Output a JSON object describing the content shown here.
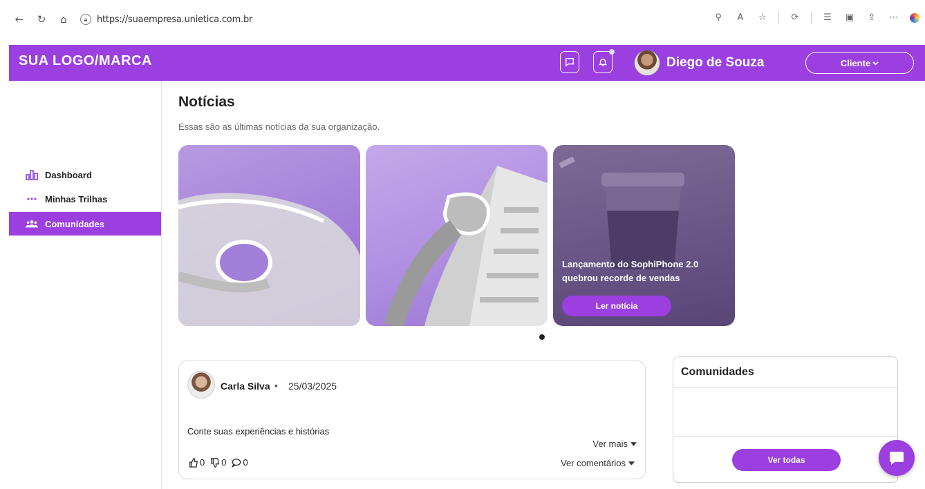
{
  "browser": {
    "url": "https://suaempresa.unietica.com.br"
  },
  "header": {
    "logo": "SUA LOGO/MARCA",
    "user_name": "Diego de Souza",
    "role": "Cliente"
  },
  "sidebar": {
    "items": [
      {
        "label": "Dashboard",
        "icon": "chart-icon"
      },
      {
        "label": "Minhas Trilhas",
        "icon": "dots-icon"
      },
      {
        "label": "Comunidades",
        "icon": "people-icon",
        "active": true
      }
    ]
  },
  "main": {
    "title": "Notícias",
    "subtitle": "Essas são as últimas notícias da sua organização.",
    "news": [
      {
        "title": "",
        "button": ""
      },
      {
        "title": "",
        "button": ""
      },
      {
        "title": "Lançamento do SophiPhone 2.0 quebrou recorde de vendas",
        "button": "Ler notícia"
      }
    ]
  },
  "post": {
    "author": "Carla Silva",
    "separator": "•",
    "date": "25/03/2025",
    "text": "Conte suas experiências e histórias",
    "see_more": "Ver mais",
    "see_comments": "Ver comentários",
    "likes": "0",
    "dislikes": "0",
    "comments": "0"
  },
  "communities": {
    "title": "Comunidades",
    "button": "Ver todas"
  },
  "colors": {
    "accent": "#9b3fe0"
  }
}
